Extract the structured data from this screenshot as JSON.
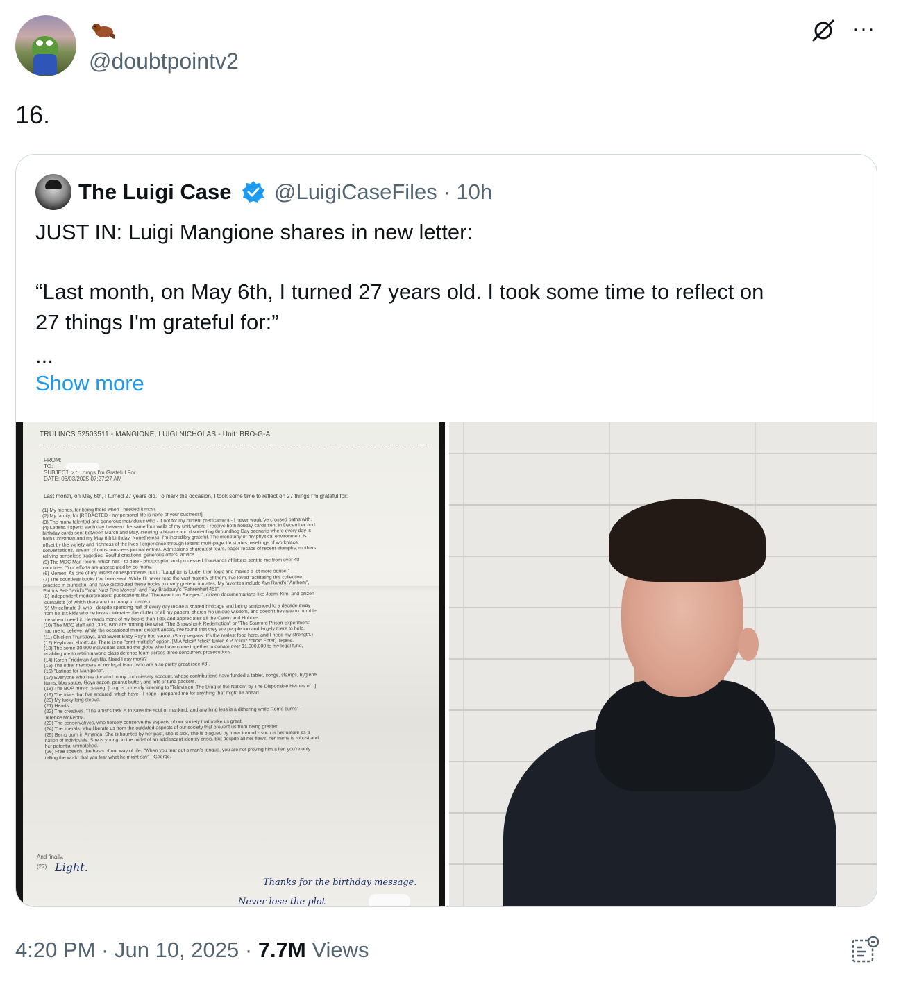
{
  "post": {
    "handle": "@doubtpointv2",
    "text": "16.",
    "timestamp": "4:20 PM · Jun 10, 2025 · ",
    "views_count": "7.7M",
    "views_label": " Views"
  },
  "quoted": {
    "name": "The Luigi Case",
    "handle_time": "@LuigiCaseFiles · 10h",
    "line1": "JUST IN: Luigi Mangione shares in new letter:",
    "line2": "“Last month, on May 6th, I turned 27 years old. I took some time to reflect on",
    "line3": "27 things I'm grateful for:”",
    "line4": "...",
    "show_more": "Show more"
  },
  "letter": {
    "header": "TRULINCS  52503511  -  MANGIONE, LUIGI NICHOLAS  -  Unit: BRO-G-A",
    "from": "FROM:",
    "to": "TO:",
    "subject": "SUBJECT: 27 Things I'm Grateful For",
    "date": "DATE: 06/03/2025 07:27:27 AM",
    "intro": "Last month, on May 6th, I turned 27 years old. To mark the occasion, I took some time to reflect on 27 things I'm grateful for:",
    "items": [
      "(1) My friends, for being there when I needed it most.",
      "(2) My family, for [REDACTED - my personal life is none of your business!]",
      "(3) The many talented and generous individuals who - if not for my current predicament - I never would've crossed paths with.",
      "(4) Letters. I spend each day between the same four walls of my unit, where I receive both holiday cards sent in December and",
      "birthday cards sent between March and May, creating a bizarre and disorienting Groundhog Day scenario where every day is",
      "both Christmas and my May 6th birthday. Nonetheless, I'm incredibly grateful. The monotony of my physical environment is",
      "offset by the variety and richness of the lives I experience through letters: multi-page life stories, retellings of workplace",
      "conversations, stream of consciousness journal entries. Admissions of greatest fears, eager recaps of recent triumphs, mothers",
      "reliving senseless tragedies. Soulful creations, generous offers, advice.",
      "(5) The MDC Mail Room, which has - to date - photocopied and processed thousands of letters sent to me from over 40",
      "countries. Your efforts are appreciated by so many.",
      "(6) Memes. As one of my wisest correspondents put it: \"Laughter is louder than logic and makes a lot more sense.\"",
      "(7) The countless books I've been sent. While I'll never read the vast majority of them, I've loved facilitating this collective",
      "practice in tsundoku, and have distributed these books to many grateful inmates. My favorites include Ayn Rand's \"Anthem\",",
      "Patrick Bet-David's \"Your Next Five Moves\", and Ray Bradbury's \"Fahrenheit 451\".",
      "(8) Independent media/creators: publications like \"The American Prospect\", citizen documentarians like Joomi Kim, and citizen",
      "journalists (of which there are too many to name.)",
      "(9) My cellmate J, who - despite spending half of every day inside a shared birdcage and being sentenced to a decade away",
      "from his six kids who he loves - tolerates the clutter of all my papers, shares his unique wisdom, and doesn't hesitate to humble",
      "me when I need it. He reads more of my books than I do, and appreciates all the Calvin and Hobbes.",
      "(10) The MDC staff and CO's, who are nothing like what \"The Shawshank Redemption\" or \"The Stanford Prison Experiment\"",
      "had me to believe. While the occasional minor dissent arises, I've found that they are people too and largely there to help.",
      "(11) Chicken Thursdays, and Sweet Baby Ray's bbq sauce. (Sorry vegans. It's the realest food here, and I need my strength.)",
      "(12) Keyboard shortcuts. There is no \"print multiple\" option. [M A *click* *click* Enter X P *click* *click* Enter], repeat.",
      "(13) The some 30,000 individuals around the globe who have come together to donate over $1,000,000 to my legal fund,",
      "enabling me to retain a world class defense team across three concurrent prosecutions.",
      "(14) Karen Friedman Agnifilo. Need I say more?",
      "(15) The other members of my legal team, who are also pretty great (see #3).",
      "(16) \"Latinas for Mangione\".",
      "(17) Everyone who has donated to my commissary account, whose contributions have funded a tablet, songs, stamps, hygiene",
      "items, bbq sauce, Goya sazon, peanut butter, and lots of tuna packets.",
      "(18) The BOP music catalog. [Luigi is currently listening to \"Television: The Drug of the Nation\" by The Disposable Heroes of...]",
      "(19) The trials that I've endured, which have - I hope - prepared me for anything that might lie ahead.",
      "(20) My lucky long sleeve.",
      "(21) Hearts.",
      "(22) The creatives. \"The artist's task is to save the soul of mankind; and anything less is a dithering while Rome burns\" -",
      "Terence McKenna.",
      "(23) The conservatives, who fiercely conserve the aspects of our society that make us great.",
      "(24) The liberals, who liberate us from the outdated aspects of our society that prevent us from being greater.",
      "(25) Being born in America. She is haunted by her past, she is sick, she is plagued by inner turmoil - such is her nature as a",
      "nation of individuals. She is young, in the midst of an adolescent identity crisis. But despite all her flaws, her frame is robust and",
      "her potential unmatched.",
      "(26) Free speech, the basis of our way of life. \"When you tear out a man's tongue, you are not proving him a liar, you're only",
      "telling the world that you fear what he might say\" - George."
    ],
    "finally": "And finally,",
    "n27": "(27)",
    "light": "Light.",
    "sig1": "Thanks for the birthday message.",
    "sig2": "Never lose the plot"
  },
  "icons": {
    "emoji": "beaver-icon",
    "grok": "grok-icon",
    "more": "more-icon",
    "verified": "verified-badge-icon",
    "analytics": "analytics-icon"
  },
  "colors": {
    "link": "#1d9bf0",
    "verified": "#1d9bf0",
    "secondary_text": "#536471"
  }
}
